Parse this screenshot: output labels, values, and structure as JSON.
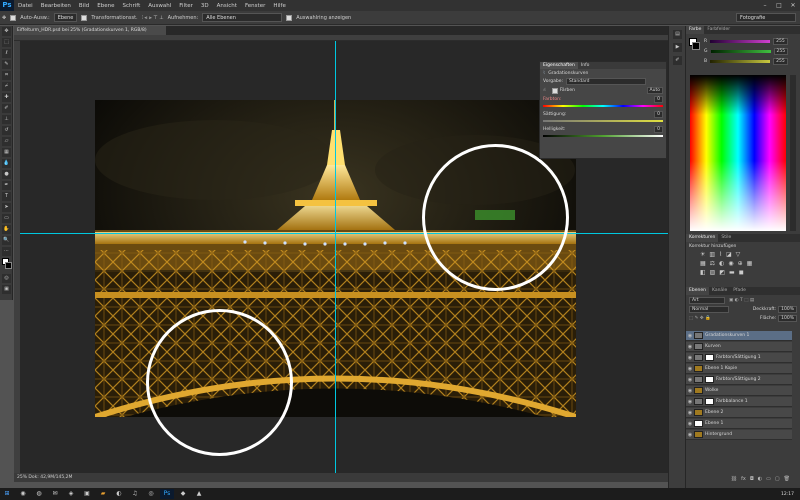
{
  "app": {
    "logo": "Ps"
  },
  "menu": [
    "Datei",
    "Bearbeiten",
    "Bild",
    "Ebene",
    "Schrift",
    "Auswahl",
    "Filter",
    "3D",
    "Ansicht",
    "Fenster",
    "Hilfe"
  ],
  "window_buttons": [
    "–",
    "□",
    "✕"
  ],
  "options": {
    "auto_select_label": "Auto-Ausw.:",
    "auto_select_value": "Ebene",
    "transform_label": "Transformationsst.",
    "sample_label": "Aufnehmen:",
    "sample_value": "Alle Ebenen",
    "show_label": "Auswahlring anzeigen",
    "workspace": "Fotografie"
  },
  "document": {
    "tab": "Eiffelturm_HDR.psd bei 25% (Gradationskurven 1, RGB/8)"
  },
  "adjustments": {
    "tabs": [
      "Eigenschaften",
      "Info"
    ],
    "title": "Gradationskurven",
    "preset_label": "Vorgabe:",
    "preset_value": "Standard",
    "colorize_label": "Färben",
    "auto_label": "Auto",
    "sliders": [
      {
        "label": "Farbton:",
        "value": "0"
      },
      {
        "label": "Sättigung:",
        "value": "0"
      },
      {
        "label": "Helligkeit:",
        "value": "0"
      }
    ]
  },
  "color_panel": {
    "tabs": [
      "Farbe",
      "Farbfelder"
    ],
    "channels": [
      {
        "label": "R",
        "value": "255",
        "color": "#d040d0"
      },
      {
        "label": "G",
        "value": "255",
        "color": "#40c040"
      },
      {
        "label": "B",
        "value": "255",
        "color": "#c8c840"
      }
    ]
  },
  "adjust_panel": {
    "tabs": [
      "Korrekturen",
      "Stile"
    ],
    "title": "Korrektur hinzufügen"
  },
  "layers_panel": {
    "tabs": [
      "Ebenen",
      "Kanäle",
      "Pfade"
    ],
    "kind_label": "Art",
    "blend_mode": "Normal",
    "opacity_label": "Deckkraft:",
    "opacity_value": "100%",
    "fill_label": "Fläche:",
    "fill_value": "100%",
    "layers": [
      {
        "name": "Gradationskurven 1",
        "type": "adj",
        "selected": true
      },
      {
        "name": "Kurven",
        "type": "adj",
        "selected": false
      },
      {
        "name": "Farbton/Sättigung 1",
        "type": "mask",
        "selected": false
      },
      {
        "name": "Ebene 1 Kopie",
        "type": "photo",
        "selected": false
      },
      {
        "name": "Farbton/Sättigung 2",
        "type": "mask",
        "selected": false
      },
      {
        "name": "Wolke",
        "type": "photo",
        "selected": false
      },
      {
        "name": "Farbbalance 1",
        "type": "mask",
        "selected": false
      },
      {
        "name": "Ebene 2",
        "type": "photo",
        "selected": false
      },
      {
        "name": "Ebene 1",
        "type": "white",
        "selected": false
      },
      {
        "name": "Hintergrund",
        "type": "photo",
        "selected": false
      }
    ]
  },
  "status": {
    "text": "25%      Dok: 42,9M/145,2M"
  },
  "taskbar": {
    "clock": "12:17"
  },
  "colors": {
    "guide": "#00c8e0",
    "tower": "#e0a020",
    "badge": "#3a8a2a"
  }
}
